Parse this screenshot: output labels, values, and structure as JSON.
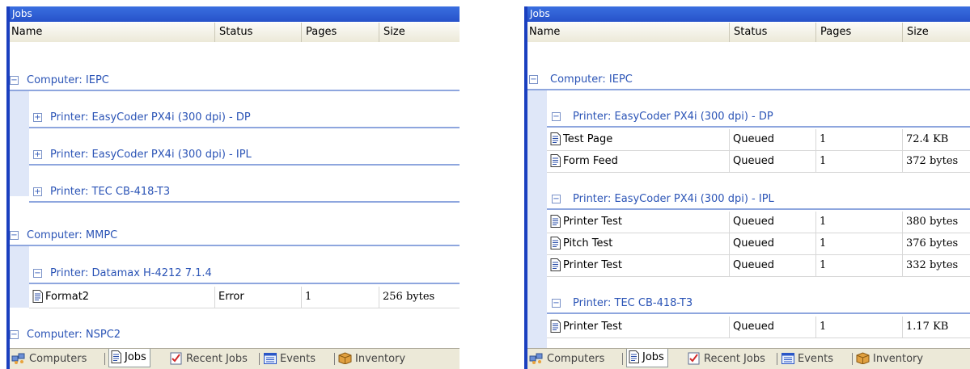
{
  "panels": [
    {
      "title": "Jobs",
      "columns": [
        "Name",
        "Status",
        "Pages",
        "Size"
      ],
      "groups": [
        {
          "label": "Computer: IEPC",
          "toggle": "−"
        },
        {
          "label": "Printer: EasyCoder PX4i (300 dpi) - DP",
          "toggle": "+"
        },
        {
          "label": "Printer: EasyCoder PX4i (300 dpi) - IPL",
          "toggle": "+"
        },
        {
          "label": "Printer: TEC CB-418-T3",
          "toggle": "+"
        },
        {
          "label": "Computer: MMPC",
          "toggle": "−"
        },
        {
          "label": "Printer: Datamax H-4212 7.1.4",
          "toggle": "−"
        },
        {
          "label": "Computer: NSPC2",
          "toggle": "−"
        }
      ],
      "rows": [
        {
          "name": "Format2",
          "status": "Error",
          "pages": "1",
          "size": "256 bytes"
        }
      ],
      "tabs": [
        "Computers",
        "Jobs",
        "Recent Jobs",
        "Events",
        "Inventory"
      ],
      "active_tab": "Jobs"
    },
    {
      "title": "Jobs",
      "columns": [
        "Name",
        "Status",
        "Pages",
        "Size"
      ],
      "groups": [
        {
          "label": "Computer: IEPC",
          "toggle": "−"
        },
        {
          "label": "Printer: EasyCoder PX4i (300 dpi) - DP",
          "toggle": "−"
        },
        {
          "label": "Printer: EasyCoder PX4i (300 dpi) - IPL",
          "toggle": "−"
        },
        {
          "label": "Printer: TEC CB-418-T3",
          "toggle": "−"
        }
      ],
      "rows": [
        {
          "name": "Test Page",
          "status": "Queued",
          "pages": "1",
          "size": "72.4 KB"
        },
        {
          "name": "Form Feed",
          "status": "Queued",
          "pages": "1",
          "size": "372 bytes"
        },
        {
          "name": "Printer Test",
          "status": "Queued",
          "pages": "1",
          "size": "380 bytes"
        },
        {
          "name": "Pitch Test",
          "status": "Queued",
          "pages": "1",
          "size": "376 bytes"
        },
        {
          "name": "Printer Test",
          "status": "Queued",
          "pages": "1",
          "size": "332 bytes"
        },
        {
          "name": "Printer Test",
          "status": "Queued",
          "pages": "1",
          "size": "1.17 KB"
        }
      ],
      "tabs": [
        "Computers",
        "Jobs",
        "Recent Jobs",
        "Events",
        "Inventory"
      ],
      "active_tab": "Jobs"
    }
  ],
  "colors": {
    "title_bar": "#2752c9",
    "group_text": "#2b54b6",
    "group_rule": "#8ea6de",
    "indent_band": "#dfe7f8",
    "tab_bar": "#ece9d8"
  },
  "icons": {
    "computers_tab": "computers-icon",
    "jobs_tab": "document-icon",
    "recent_jobs_tab": "checkmark-icon",
    "events_tab": "events-icon",
    "inventory_tab": "box-icon",
    "job_row": "document-icon",
    "group_toggle_expanded": "minus-icon",
    "group_toggle_collapsed": "plus-icon"
  }
}
